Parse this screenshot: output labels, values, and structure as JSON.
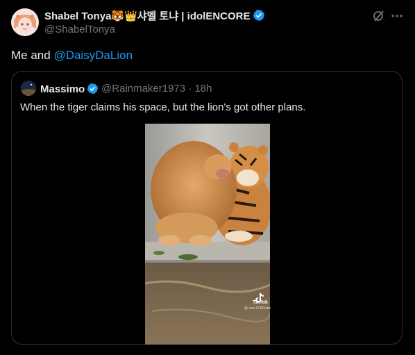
{
  "author": {
    "display_name": "Shabel Tonya🐯👑샤벨 토냐 | idolENCORE",
    "handle": "@ShabelTonya"
  },
  "tweet": {
    "text": "Me and ",
    "mention": "@DaisyDaLion"
  },
  "quoted": {
    "display_name": "Massimo",
    "handle_time": "@Rainmaker1973 · 18h",
    "text": "When the tiger claims his space, but the lion's got other plans."
  },
  "media": {
    "watermark": "TikTok",
    "watermark_user": "@ user12345abc"
  },
  "icons": [
    "grok-icon",
    "more-icon",
    "verified-badge-icon",
    "tiktok-icon"
  ],
  "colors": {
    "accent": "#1d9bf0",
    "background": "#000000",
    "muted": "#71767b"
  }
}
